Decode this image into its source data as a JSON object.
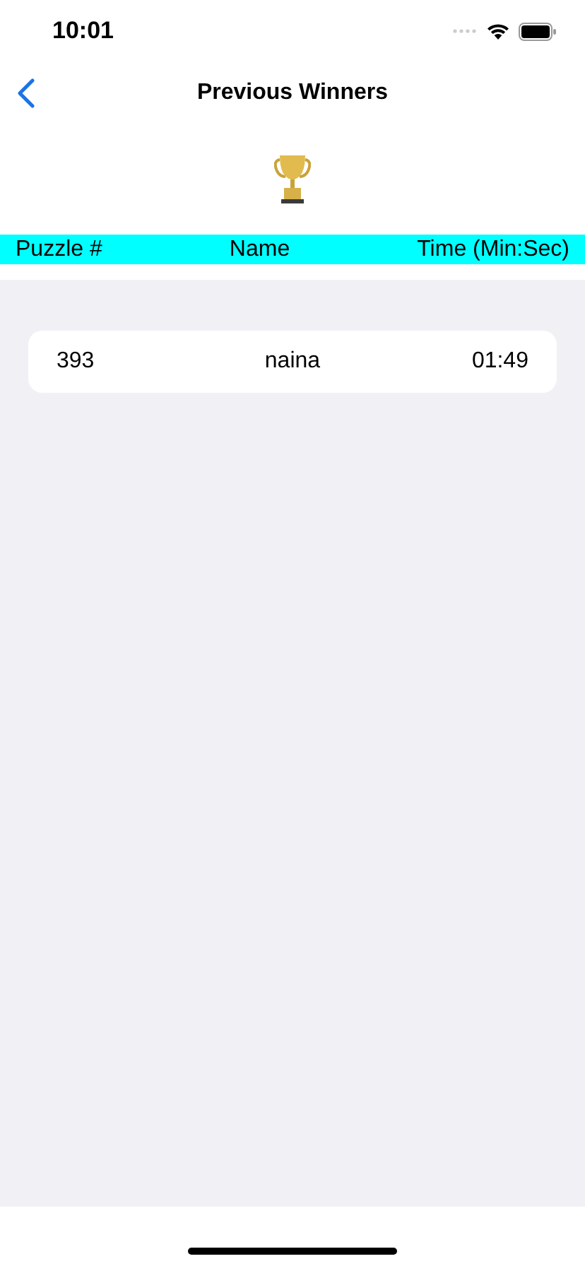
{
  "status_bar": {
    "time": "10:01"
  },
  "nav": {
    "title": "Previous Winners"
  },
  "table": {
    "columns": [
      "Puzzle #",
      "Name",
      "Time (Min:Sec)"
    ],
    "rows": [
      {
        "puzzle": "393",
        "name": "naina",
        "time": "01:49"
      }
    ]
  }
}
